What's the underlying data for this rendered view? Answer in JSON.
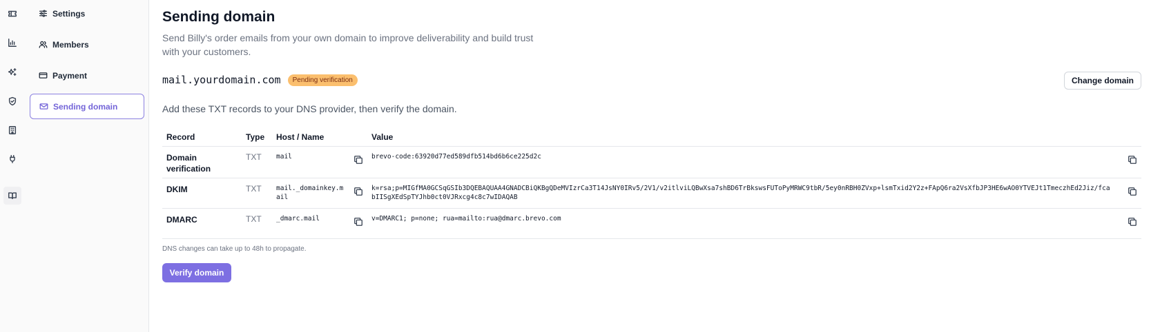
{
  "rail": {
    "icons": [
      "ticket-icon",
      "bar-chart-icon",
      "sparkles-icon",
      "shield-check-icon",
      "building-icon",
      "plug-icon",
      "book-open-icon"
    ]
  },
  "nav": {
    "items": [
      {
        "label": "Settings",
        "icon": "sliders-icon"
      },
      {
        "label": "Members",
        "icon": "users-icon"
      },
      {
        "label": "Payment",
        "icon": "credit-card-icon"
      },
      {
        "label": "Sending domain",
        "icon": "mail-icon",
        "active": true
      }
    ]
  },
  "page": {
    "title": "Sending domain",
    "subtitle": "Send Billy's order emails from your own domain to improve deliverability and build trust with your customers."
  },
  "domain": {
    "name": "mail.yourdomain.com",
    "status": "Pending verification",
    "change_label": "Change domain"
  },
  "instructions": "Add these TXT records to your DNS provider, then verify the domain.",
  "table": {
    "headers": [
      "Record",
      "Type",
      "Host / Name",
      "Value"
    ],
    "rows": [
      {
        "record": "Domain verification",
        "type": "TXT",
        "host": "mail",
        "value": "brevo-code:63920d77ed589dfb514bd6b6ce225d2c"
      },
      {
        "record": "DKIM",
        "type": "TXT",
        "host": "mail._domainkey.mail",
        "value": "k=rsa;p=MIGfMA0GCSqGSIb3DQEBAQUAA4GNADCBiQKBgQDeMVIzrCa3T14JsNY0IRv5/2V1/v2itlviLQBwXsa7shBD6TrBkswsFUToPyMRWC9tbR/5ey0nRBH0ZVxp+lsmTxid2Y2z+FApQ6ra2VsXfbJP3HE6wAO0YTVEJt1TmeczhEd2Jiz/fcabIISgXEdSpTYJhb0ct0VJRxcg4c8c7wIDAQAB"
      },
      {
        "record": "DMARC",
        "type": "TXT",
        "host": "_dmarc.mail",
        "value": "v=DMARC1; p=none; rua=mailto:rua@dmarc.brevo.com"
      }
    ]
  },
  "note": "DNS changes can take up to 48h to propagate.",
  "verify_label": "Verify domain",
  "colors": {
    "accent": "#7d6fe2",
    "badge_bg": "#fbbf6e",
    "badge_text": "#7c2d12"
  }
}
